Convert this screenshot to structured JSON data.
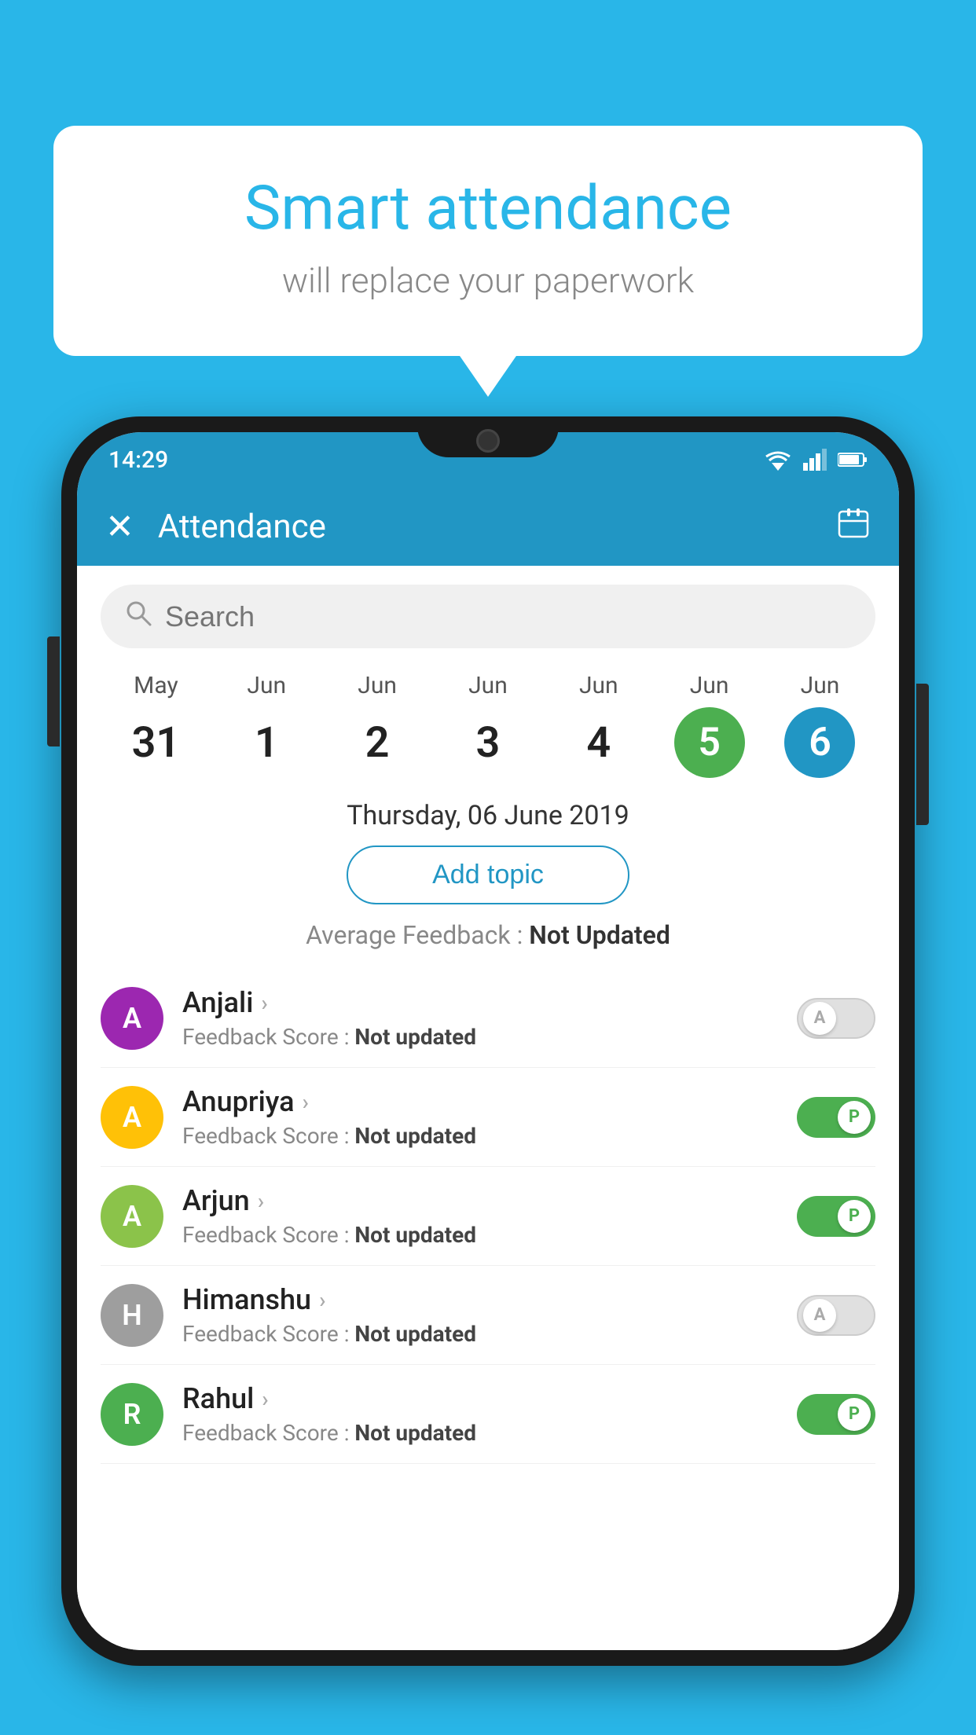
{
  "background_color": "#29B6E8",
  "speech_bubble": {
    "title": "Smart attendance",
    "subtitle": "will replace your paperwork"
  },
  "status_bar": {
    "time": "14:29",
    "wifi": "▼",
    "signal": "▲",
    "battery": "▌"
  },
  "app_bar": {
    "title": "Attendance",
    "close_icon": "✕",
    "calendar_icon": "📅"
  },
  "search": {
    "placeholder": "Search"
  },
  "date_strip": [
    {
      "month": "May",
      "day": "31",
      "state": "normal"
    },
    {
      "month": "Jun",
      "day": "1",
      "state": "normal"
    },
    {
      "month": "Jun",
      "day": "2",
      "state": "normal"
    },
    {
      "month": "Jun",
      "day": "3",
      "state": "normal"
    },
    {
      "month": "Jun",
      "day": "4",
      "state": "normal"
    },
    {
      "month": "Jun",
      "day": "5",
      "state": "active-green"
    },
    {
      "month": "Jun",
      "day": "6",
      "state": "active-blue"
    }
  ],
  "selected_date": "Thursday, 06 June 2019",
  "add_topic_label": "Add topic",
  "average_feedback": {
    "label": "Average Feedback : ",
    "value": "Not Updated"
  },
  "students": [
    {
      "name": "Anjali",
      "avatar_letter": "A",
      "avatar_color": "#9C27B0",
      "feedback": "Feedback Score : ",
      "feedback_value": "Not updated",
      "toggle_state": "off",
      "toggle_letter": "A"
    },
    {
      "name": "Anupriya",
      "avatar_letter": "A",
      "avatar_color": "#FFC107",
      "feedback": "Feedback Score : ",
      "feedback_value": "Not updated",
      "toggle_state": "on",
      "toggle_letter": "P"
    },
    {
      "name": "Arjun",
      "avatar_letter": "A",
      "avatar_color": "#8BC34A",
      "feedback": "Feedback Score : ",
      "feedback_value": "Not updated",
      "toggle_state": "on",
      "toggle_letter": "P"
    },
    {
      "name": "Himanshu",
      "avatar_letter": "H",
      "avatar_color": "#9E9E9E",
      "feedback": "Feedback Score : ",
      "feedback_value": "Not updated",
      "toggle_state": "off",
      "toggle_letter": "A"
    },
    {
      "name": "Rahul",
      "avatar_letter": "R",
      "avatar_color": "#4CAF50",
      "feedback": "Feedback Score : ",
      "feedback_value": "Not updated",
      "toggle_state": "on",
      "toggle_letter": "P"
    }
  ]
}
